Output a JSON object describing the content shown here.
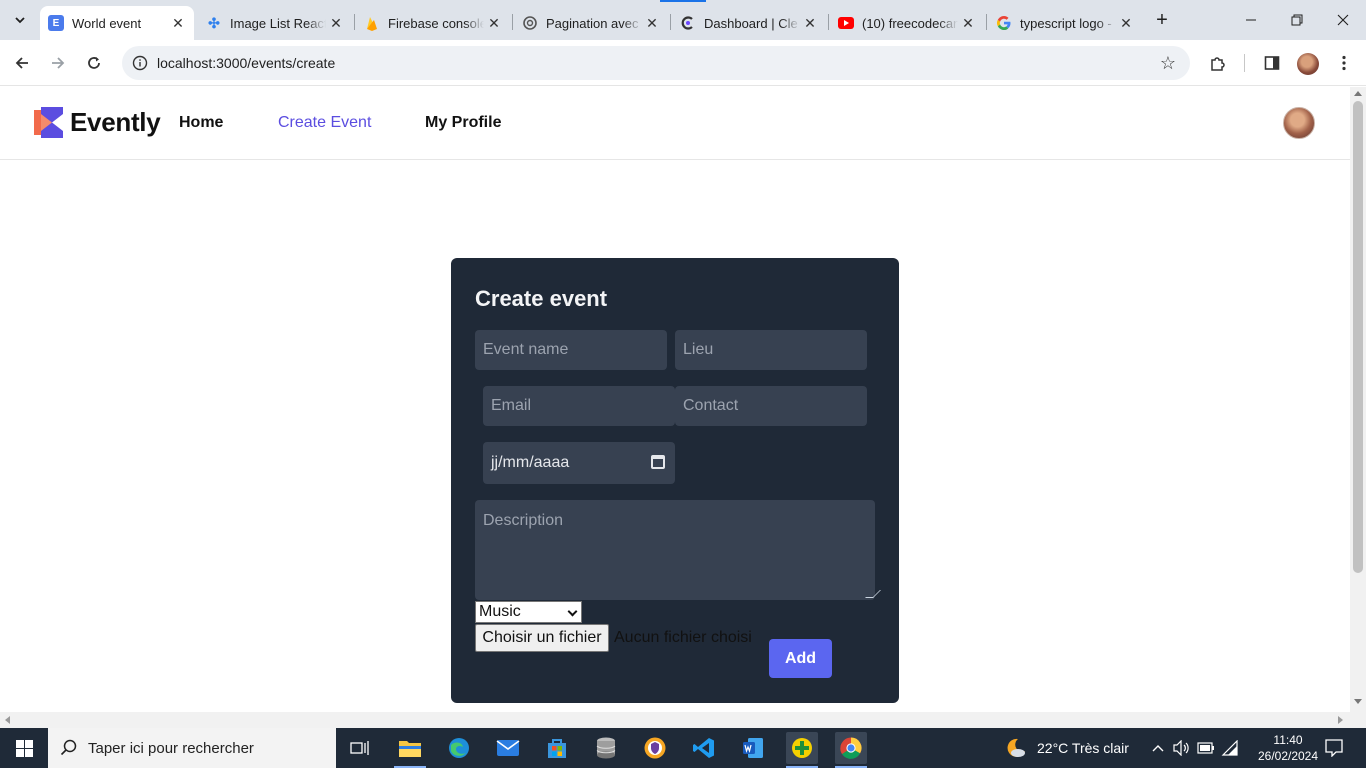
{
  "browser": {
    "tabs": [
      {
        "title": "World event",
        "active": true
      },
      {
        "title": "Image List React",
        "active": false
      },
      {
        "title": "Firebase console",
        "active": false
      },
      {
        "title": "Pagination avec",
        "active": false
      },
      {
        "title": "Dashboard | Cle",
        "active": false
      },
      {
        "title": "(10) freecodecan",
        "active": false
      },
      {
        "title": "typescript logo -",
        "active": false
      }
    ],
    "url": "localhost:3000/events/create"
  },
  "app": {
    "brand": "Evently",
    "nav": {
      "home": "Home",
      "create_event": "Create Event",
      "my_profile": "My Profile"
    }
  },
  "form": {
    "title": "Create event",
    "event_name_placeholder": "Event name",
    "lieu_placeholder": "Lieu",
    "email_placeholder": "Email",
    "contact_placeholder": "Contact",
    "date_value": "jj/mm/aaaa",
    "description_placeholder": "Description",
    "category_selected": "Music",
    "file_button": "Choisir un fichier",
    "file_status": "Aucun fichier choisi",
    "submit": "Add"
  },
  "taskbar": {
    "search_placeholder": "Taper ici pour rechercher",
    "weather": "22°C  Très clair",
    "time": "11:40",
    "date": "26/02/2024"
  },
  "colors": {
    "accent": "#5b4de0",
    "card_bg": "#1f2937",
    "field_bg": "#374151",
    "add_button": "#5b66f0"
  }
}
